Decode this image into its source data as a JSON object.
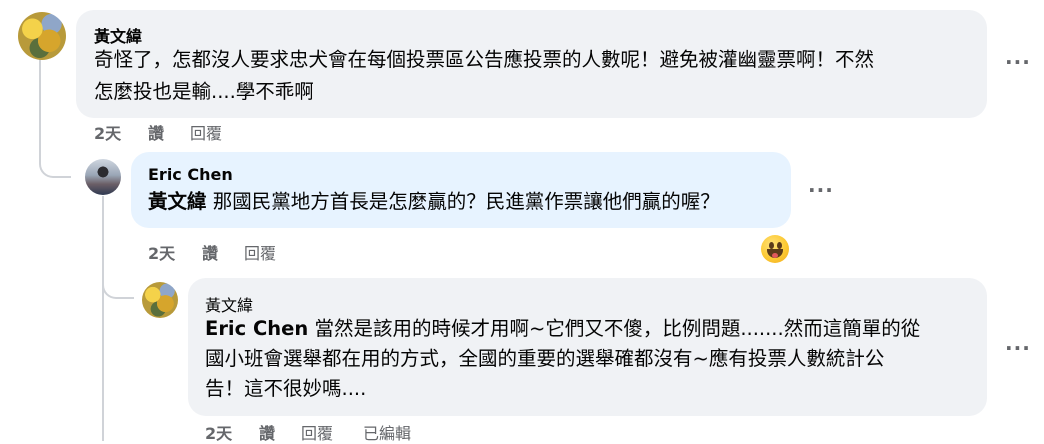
{
  "comments": [
    {
      "author": "黃文緯",
      "lines": [
        "奇怪了，怎都沒人要求忠犬會在每個投票區公告應投票的人數呢！避免被灌幽靈票啊！不然",
        "怎麼投也是輸....學不乖啊"
      ],
      "time": "2天",
      "like": "讚",
      "reply": "回覆"
    },
    {
      "author": "Eric Chen",
      "mention": "黃文緯",
      "lines": [
        " 那國民黨地方首長是怎麼贏的？民進黨作票讓他們贏的喔？"
      ],
      "time": "2天",
      "like": "讚",
      "reply": "回覆"
    },
    {
      "author": "黃文緯",
      "mention": "Eric Chen",
      "lines": [
        " 當然是該用的時候才用啊~它們又不傻，比例問題.......然而這簡單的從",
        "國小班會選舉都在用的方式，全國的重要的選舉確都沒有~應有投票人數統計公",
        "告！這不很妙嗎...."
      ],
      "time": "2天",
      "like": "讚",
      "reply": "回覆",
      "edited": "已編輯"
    }
  ],
  "more_glyph": "···",
  "colors": {
    "bubble": "#f0f2f5",
    "bubble_highlight": "#e7f3ff",
    "muted_text": "#65676b",
    "thread_line": "#d0d3d8"
  }
}
